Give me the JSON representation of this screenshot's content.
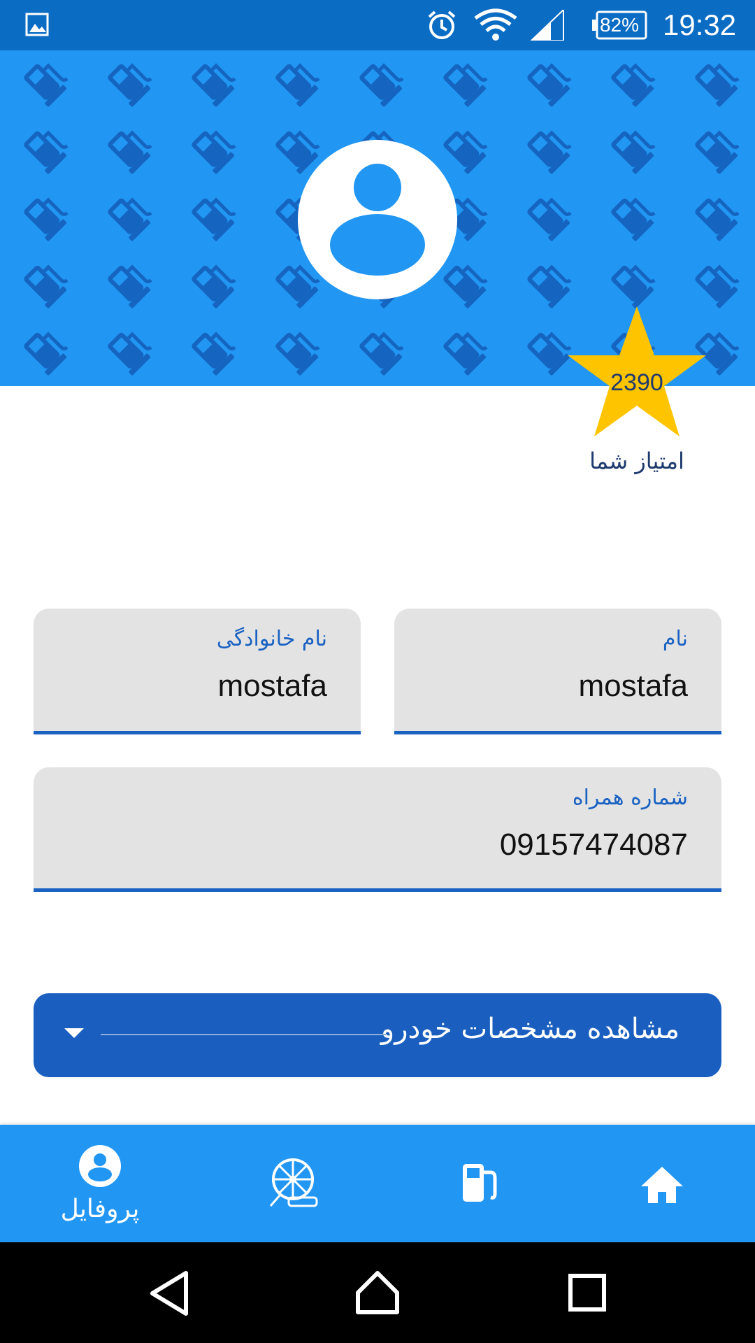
{
  "status_bar": {
    "time": "19:32",
    "battery": "82%",
    "icons": [
      "gallery-icon",
      "alarm-icon",
      "wifi-icon",
      "signal-icon",
      "battery-icon"
    ]
  },
  "header": {
    "background_pattern": "fuel-pump-icon",
    "avatar": "user-avatar-icon",
    "colors": {
      "header_bg": "#2196f3",
      "star": "#ffc400"
    }
  },
  "score": {
    "value": "2390",
    "label": "امتیاز شما"
  },
  "form": {
    "first_name": {
      "label": "نام",
      "value": "mostafa"
    },
    "last_name": {
      "label": "نام خانوادگی",
      "value": "mostafa"
    },
    "mobile": {
      "label": "شماره همراه",
      "value": "09157474087"
    }
  },
  "vehicle_button": {
    "label": "مشاهده مشخصات خودرو",
    "icon": "chevron-down-icon"
  },
  "bottom_nav": {
    "items": [
      {
        "icon": "profile-icon",
        "label": "پروفایل",
        "active": true
      },
      {
        "icon": "wheel-of-fortune-icon"
      },
      {
        "icon": "fuel-pump-icon"
      },
      {
        "icon": "home-icon"
      }
    ]
  },
  "system_nav": [
    "back-icon",
    "home-icon",
    "recents-icon"
  ]
}
